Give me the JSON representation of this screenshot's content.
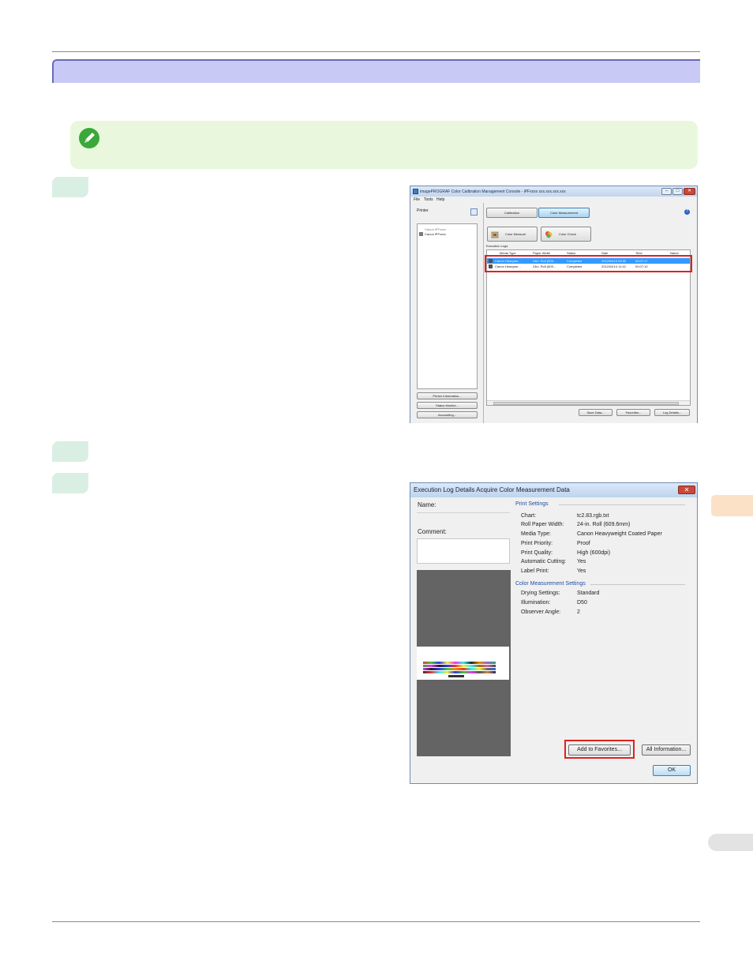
{
  "app_window": {
    "title": "imagePROGRAF Color Calibration Management Console - iPFxxxx xxx.xxx.xxx.xxx",
    "menu": [
      "File",
      "Tools",
      "Help"
    ],
    "printer_label": "Printer",
    "printer_group": "Canon iPFxxxx",
    "printer_item": "Canon iPFxxxx",
    "left_buttons": [
      "Printer Information...",
      "Status Monitor...",
      "Accounting..."
    ],
    "tabs": [
      "Calibration",
      "Color Measurement"
    ],
    "active_tab": "Color Measurement",
    "help": "?",
    "tool_buttons": [
      "Color Measure",
      "Color Check"
    ],
    "logs_label": "Execution Logs",
    "columns": [
      "Media Type",
      "Paper Width",
      "Status",
      "Start",
      "Time",
      "Name"
    ],
    "rows": [
      [
        "Canon Heavywe...",
        "24in. Roll (609...",
        "Completed",
        "2012/04/13 03:32",
        "00:07:17",
        ""
      ],
      [
        "Canon Heavywe...",
        "24in. Roll (609...",
        "Completed",
        "2012/04/14 11:42",
        "00:07:10",
        ""
      ]
    ],
    "bottom_buttons": [
      "Save Data...",
      "Favorites...",
      "Log Details..."
    ]
  },
  "details_dialog": {
    "title": "Execution Log Details Acquire Color Measurement Data",
    "close": "✕",
    "name_label": "Name:",
    "comment_label": "Comment:",
    "print_settings_title": "Print Settings",
    "print_settings": [
      {
        "k": "Chart:",
        "v": "tc2.83.rgb.txt"
      },
      {
        "k": "Roll Paper Width:",
        "v": "24-in. Roll (609.6mm)"
      },
      {
        "k": "Media Type:",
        "v": "Canon Heavyweight Coated Paper"
      },
      {
        "k": "Print Priority:",
        "v": "Proof"
      },
      {
        "k": "Print Quality:",
        "v": "High (600dpi)"
      },
      {
        "k": "Automatic Cutting:",
        "v": "Yes"
      },
      {
        "k": "Label Print:",
        "v": "Yes"
      }
    ],
    "color_settings_title": "Color Measurement Settings",
    "color_settings": [
      {
        "k": "Drying Settings:",
        "v": "Standard"
      },
      {
        "k": "Illumination:",
        "v": "D50"
      },
      {
        "k": "Observer Angle:",
        "v": "2"
      }
    ],
    "add_favorites": "Add to Favorites...",
    "all_info": "All Information...",
    "ok": "OK"
  },
  "colors": {
    "section_bar": "#c9c9f5",
    "note_box": "#e9f8dc",
    "step_tab": "#d9efe4",
    "highlight": "#e02020",
    "selection": "#3399ff"
  }
}
